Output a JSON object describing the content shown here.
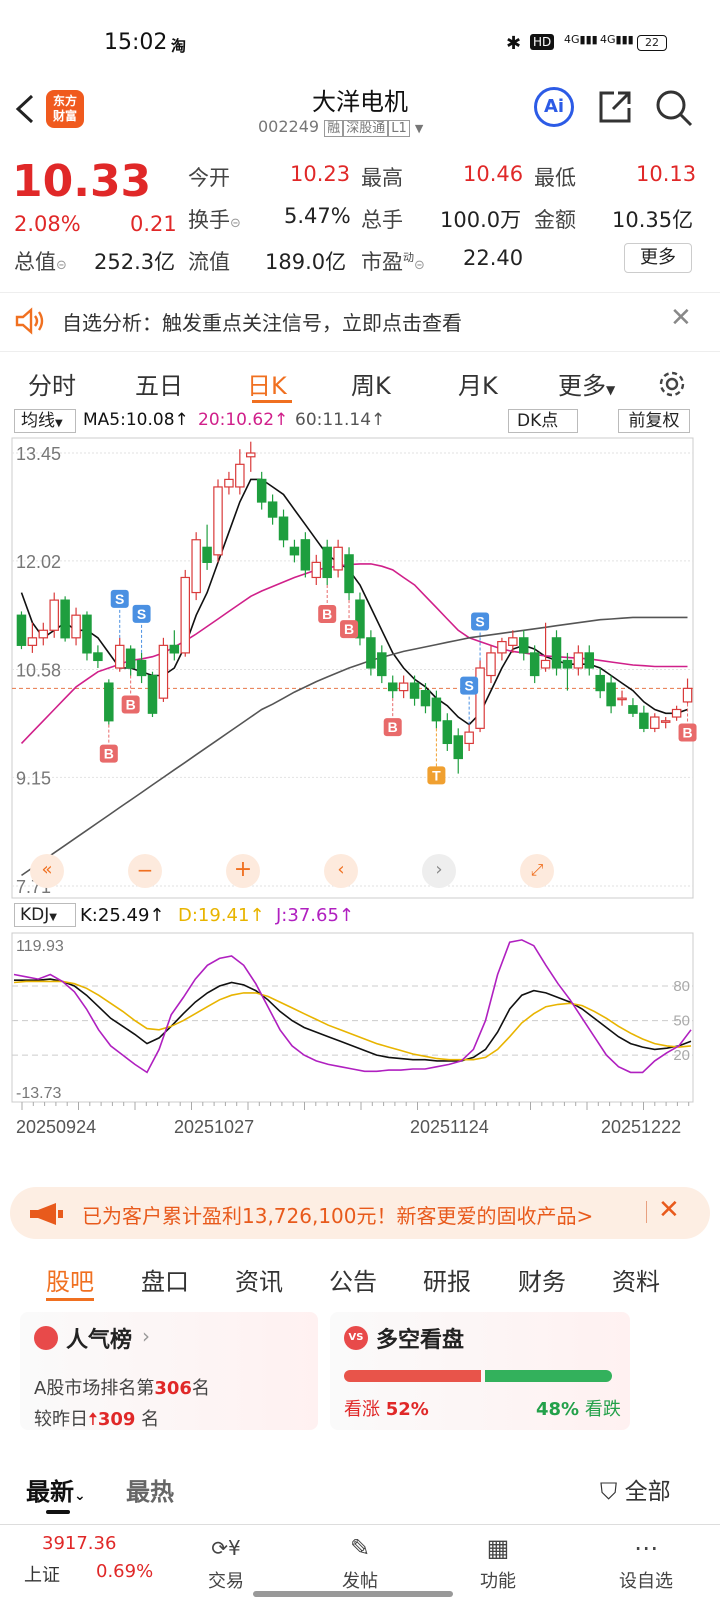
{
  "status_bar": {
    "time": "15:02",
    "app_badge": "淘",
    "battery": "22",
    "net1": "4G",
    "net2": "4G",
    "hd": "HD"
  },
  "header": {
    "stock_name": "大洋电机",
    "stock_code": "002249",
    "tags": [
      "融",
      "深股通",
      "L1"
    ],
    "logo_line1": "东方",
    "logo_line2": "财富",
    "ai_label": "Ai"
  },
  "quote": {
    "price": "10.33",
    "change_pct": "2.08%",
    "change": "0.21",
    "rows": [
      [
        {
          "label": "今开",
          "value": "10.23",
          "color": "red"
        },
        {
          "label": "最高",
          "value": "10.46",
          "color": "red"
        },
        {
          "label": "最低",
          "value": "10.13",
          "color": "red"
        }
      ],
      [
        {
          "label": "换手",
          "value": "5.47%",
          "color": "black"
        },
        {
          "label": "总手",
          "value": "100.0万",
          "color": "black"
        },
        {
          "label": "金额",
          "value": "10.35亿",
          "color": "black"
        }
      ]
    ],
    "total_cap_label": "总值",
    "total_cap": "252.3亿",
    "float_cap_label": "流值",
    "float_cap": "189.0亿",
    "pe_label": "市盈",
    "pe_sup": "动",
    "pe": "22.40",
    "more_label": "更多"
  },
  "hint": {
    "text": "自选分析：触发重点关注信号，立即点击查看"
  },
  "period_tabs": {
    "items": [
      "分时",
      "五日",
      "日K",
      "周K",
      "月K",
      "更多"
    ],
    "active": 2
  },
  "ma_bar": {
    "selector": "均线",
    "ma5": "MA5:10.08",
    "ma20": "20:10.62",
    "ma60": "60:11.14",
    "dk": "DK点",
    "adjust": "前复权"
  },
  "chart_data": [
    {
      "type": "candlestick",
      "y_axis_labels": [
        "13.45",
        "12.02",
        "10.58",
        "9.15",
        "7.71"
      ],
      "ylim": [
        7.71,
        13.45
      ],
      "x_labels": [
        "20250924",
        "20251027",
        "20251124",
        "20251222"
      ],
      "last_price": 10.33,
      "candles": [
        [
          11.3,
          10.9,
          11.35,
          10.85
        ],
        [
          10.9,
          11.0,
          11.2,
          10.8
        ],
        [
          11.0,
          11.1,
          11.2,
          10.9
        ],
        [
          11.1,
          11.5,
          11.6,
          11.0
        ],
        [
          11.5,
          11.0,
          11.55,
          10.95
        ],
        [
          11.0,
          11.3,
          11.4,
          10.9
        ],
        [
          11.3,
          10.8,
          11.35,
          10.7
        ],
        [
          10.8,
          10.7,
          10.9,
          10.6
        ],
        [
          10.4,
          9.9,
          10.45,
          9.85
        ],
        [
          10.6,
          10.9,
          11.0,
          10.55
        ],
        [
          10.85,
          10.6,
          10.9,
          10.5
        ],
        [
          10.7,
          10.5,
          10.8,
          10.4
        ],
        [
          10.5,
          10.0,
          10.55,
          9.95
        ],
        [
          10.2,
          10.9,
          11.0,
          10.15
        ],
        [
          10.9,
          10.8,
          11.1,
          10.7
        ],
        [
          10.8,
          11.8,
          11.9,
          10.75
        ],
        [
          11.6,
          12.3,
          12.4,
          11.5
        ],
        [
          12.2,
          12.0,
          12.5,
          11.9
        ],
        [
          12.1,
          13.0,
          13.1,
          12.0
        ],
        [
          13.0,
          13.1,
          13.2,
          12.9
        ],
        [
          13.0,
          13.3,
          13.5,
          12.9
        ],
        [
          13.4,
          13.45,
          13.6,
          13.2
        ],
        [
          13.1,
          12.8,
          13.2,
          12.7
        ],
        [
          12.8,
          12.6,
          12.9,
          12.5
        ],
        [
          12.6,
          12.3,
          12.7,
          12.2
        ],
        [
          12.2,
          12.1,
          12.3,
          12.0
        ],
        [
          12.3,
          11.9,
          12.4,
          11.8
        ],
        [
          11.8,
          12.0,
          12.1,
          11.7
        ],
        [
          12.2,
          11.8,
          12.3,
          11.7
        ],
        [
          11.9,
          12.2,
          12.3,
          11.8
        ],
        [
          12.1,
          11.6,
          12.2,
          11.5
        ],
        [
          11.5,
          11.0,
          11.6,
          10.9
        ],
        [
          11.0,
          10.6,
          11.1,
          10.5
        ],
        [
          10.8,
          10.5,
          10.9,
          10.4
        ],
        [
          10.4,
          10.3,
          10.5,
          10.2
        ],
        [
          10.3,
          10.4,
          10.5,
          10.2
        ],
        [
          10.4,
          10.2,
          10.5,
          10.1
        ],
        [
          10.3,
          10.1,
          10.4,
          10.0
        ],
        [
          10.2,
          9.9,
          10.3,
          9.8
        ],
        [
          9.9,
          9.6,
          10.0,
          9.5
        ],
        [
          9.7,
          9.4,
          9.8,
          9.2
        ],
        [
          9.6,
          9.75,
          9.85,
          9.5
        ],
        [
          9.8,
          10.6,
          10.7,
          9.75
        ],
        [
          10.5,
          10.8,
          10.9,
          10.4
        ],
        [
          10.8,
          10.95,
          11.0,
          10.7
        ],
        [
          10.9,
          11.0,
          11.1,
          10.8
        ],
        [
          11.0,
          10.8,
          11.1,
          10.7
        ],
        [
          10.8,
          10.5,
          10.9,
          10.4
        ],
        [
          10.6,
          10.7,
          11.2,
          10.55
        ],
        [
          11.0,
          10.6,
          11.1,
          10.5
        ],
        [
          10.7,
          10.6,
          10.8,
          10.3
        ],
        [
          10.6,
          10.8,
          10.9,
          10.5
        ],
        [
          10.8,
          10.6,
          10.9,
          10.5
        ],
        [
          10.5,
          10.3,
          10.6,
          10.2
        ],
        [
          10.4,
          10.1,
          10.5,
          10.0
        ],
        [
          10.2,
          10.2,
          10.3,
          10.1
        ],
        [
          10.1,
          10.0,
          10.2,
          9.95
        ],
        [
          10.0,
          9.8,
          10.1,
          9.75
        ],
        [
          9.8,
          9.95,
          10.0,
          9.75
        ],
        [
          9.9,
          9.9,
          9.95,
          9.8
        ],
        [
          9.95,
          10.05,
          10.1,
          9.9
        ],
        [
          10.15,
          10.33,
          10.46,
          10.13
        ]
      ],
      "ma_lines": [
        {
          "name": "MA5",
          "color": "#111111",
          "values": [
            11.6,
            11.2,
            11.0,
            11.1,
            11.2,
            11.1,
            11.1,
            11.0,
            10.8,
            10.6,
            10.6,
            10.55,
            10.5,
            10.5,
            10.6,
            10.9,
            11.3,
            11.6,
            12.0,
            12.4,
            12.8,
            13.1,
            13.1,
            13.0,
            12.9,
            12.7,
            12.5,
            12.3,
            12.1,
            12.0,
            11.9,
            11.7,
            11.4,
            11.1,
            10.8,
            10.6,
            10.45,
            10.35,
            10.2,
            10.1,
            9.95,
            9.85,
            10.0,
            10.3,
            10.6,
            10.85,
            10.9,
            10.85,
            10.75,
            10.7,
            10.65,
            10.65,
            10.65,
            10.6,
            10.5,
            10.4,
            10.3,
            10.15,
            10.05,
            10.0,
            10.0,
            10.05
          ]
        },
        {
          "name": "MA20",
          "color": "#d0208a",
          "values": [
            9.6,
            9.75,
            9.9,
            10.05,
            10.2,
            10.35,
            10.45,
            10.55,
            10.6,
            10.65,
            10.7,
            10.72,
            10.75,
            10.8,
            10.88,
            10.96,
            11.05,
            11.15,
            11.25,
            11.35,
            11.45,
            11.55,
            11.62,
            11.68,
            11.74,
            11.8,
            11.85,
            11.9,
            11.93,
            11.95,
            11.97,
            11.98,
            11.98,
            11.95,
            11.9,
            11.8,
            11.7,
            11.55,
            11.4,
            11.25,
            11.1,
            11.0,
            10.95,
            10.9,
            10.85,
            10.82,
            10.8,
            10.78,
            10.76,
            10.75,
            10.74,
            10.73,
            10.72,
            10.7,
            10.68,
            10.66,
            10.64,
            10.63,
            10.62,
            10.62,
            10.62,
            10.62
          ]
        },
        {
          "name": "MA60",
          "color": "#555555",
          "values": [
            7.85,
            7.95,
            8.05,
            8.15,
            8.25,
            8.35,
            8.45,
            8.55,
            8.65,
            8.75,
            8.85,
            8.95,
            9.05,
            9.15,
            9.25,
            9.35,
            9.45,
            9.55,
            9.65,
            9.75,
            9.85,
            9.95,
            10.05,
            10.12,
            10.2,
            10.28,
            10.35,
            10.42,
            10.48,
            10.54,
            10.6,
            10.65,
            10.7,
            10.74,
            10.78,
            10.82,
            10.85,
            10.88,
            10.91,
            10.94,
            10.97,
            11.0,
            11.02,
            11.04,
            11.06,
            11.08,
            11.1,
            11.12,
            11.14,
            11.16,
            11.18,
            11.2,
            11.22,
            11.24,
            11.25,
            11.26,
            11.27,
            11.27,
            11.27,
            11.27,
            11.27,
            11.27
          ]
        }
      ],
      "signals": [
        {
          "label": "S",
          "index": 9,
          "type": "sell"
        },
        {
          "label": "S",
          "index": 11,
          "type": "sell"
        },
        {
          "label": "B",
          "index": 8,
          "type": "buy"
        },
        {
          "label": "B",
          "index": 10,
          "type": "buy"
        },
        {
          "label": "S",
          "index": 41,
          "type": "sell"
        },
        {
          "label": "S",
          "index": 42,
          "type": "sell"
        },
        {
          "label": "B",
          "index": 28,
          "type": "buy"
        },
        {
          "label": "B",
          "index": 30,
          "type": "buy"
        },
        {
          "label": "B",
          "index": 34,
          "type": "buy"
        },
        {
          "label": "T",
          "index": 38,
          "type": "t"
        },
        {
          "label": "B",
          "index": 61,
          "type": "buy"
        }
      ]
    },
    {
      "type": "line",
      "indicator": "KDJ",
      "y_axis_labels": [
        "119.93",
        "-13.73"
      ],
      "ylim": [
        -13.73,
        119.93
      ],
      "ref_levels": [
        80,
        50,
        20
      ],
      "series": [
        {
          "name": "K",
          "color": "#111111",
          "values": [
            85,
            85,
            85,
            86,
            84,
            80,
            72,
            62,
            52,
            45,
            38,
            30,
            35,
            45,
            56,
            66,
            74,
            80,
            83,
            81,
            76,
            68,
            58,
            50,
            44,
            40,
            36,
            32,
            28,
            24,
            20,
            18,
            17,
            16,
            16,
            15,
            15,
            15,
            18,
            25,
            40,
            60,
            72,
            76,
            74,
            70,
            66,
            60,
            52,
            44,
            36,
            30,
            27,
            25,
            26,
            28,
            32
          ]
        },
        {
          "name": "D",
          "color": "#e8b400",
          "values": [
            83,
            84,
            84,
            84,
            84,
            82,
            78,
            72,
            65,
            58,
            50,
            43,
            42,
            45,
            50,
            56,
            62,
            68,
            72,
            74,
            74,
            71,
            66,
            61,
            56,
            51,
            46,
            42,
            38,
            34,
            30,
            27,
            24,
            21,
            19,
            17,
            16,
            16,
            16,
            18,
            25,
            36,
            48,
            56,
            62,
            64,
            65,
            63,
            58,
            52,
            45,
            39,
            34,
            30,
            28,
            27,
            28
          ]
        },
        {
          "name": "J",
          "color": "#b020c0",
          "values": [
            90,
            88,
            86,
            90,
            84,
            75,
            60,
            42,
            28,
            20,
            12,
            5,
            25,
            55,
            70,
            86,
            98,
            104,
            106,
            98,
            82,
            62,
            42,
            28,
            20,
            15,
            12,
            10,
            8,
            6,
            6,
            7,
            7,
            8,
            8,
            10,
            12,
            15,
            25,
            50,
            90,
            118,
            120,
            115,
            98,
            82,
            68,
            52,
            36,
            20,
            10,
            5,
            5,
            15,
            22,
            28,
            42
          ]
        }
      ],
      "values_text": {
        "label": "KDJ",
        "k": "K:25.49",
        "d": "D:19.41",
        "j": "J:37.65"
      }
    }
  ],
  "promo": {
    "text": "已为客户累计盈利13,726,100元！新客更爱的固收产品>"
  },
  "sub_tabs": {
    "items": [
      "股吧",
      "盘口",
      "资讯",
      "公告",
      "研报",
      "财务",
      "资料"
    ],
    "active": 0
  },
  "cards": {
    "popularity": {
      "title": "人气榜",
      "line1_prefix": "A股市场排名第",
      "rank": "306",
      "line1_suffix": "名",
      "line2_prefix": "较昨日",
      "change": "309",
      "line2_suffix": "名"
    },
    "sentiment": {
      "title": "多空看盘",
      "bull_label": "看涨",
      "bull_pct": "52%",
      "bear_label": "看跌",
      "bear_pct": "48%",
      "bull_ratio": 0.52
    }
  },
  "feed_tabs": {
    "latest": "最新",
    "hot": "最热",
    "filter": "全部"
  },
  "bottom_bar": {
    "index_value": "3917.36",
    "index_name": "上证",
    "index_change": "0.69%",
    "items": [
      "交易",
      "发帖",
      "功能",
      "设自选"
    ]
  }
}
